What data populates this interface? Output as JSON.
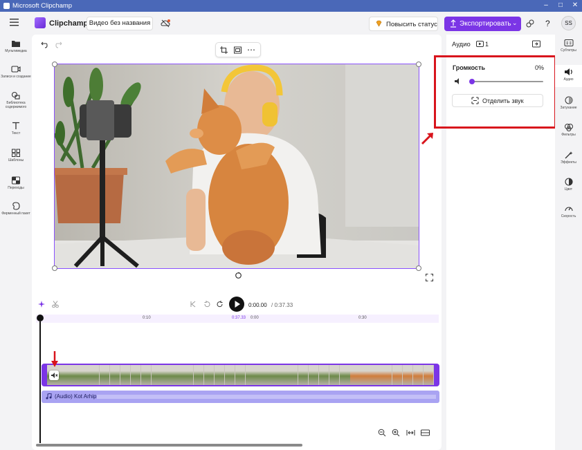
{
  "window": {
    "title": "Microsoft Clipchamp"
  },
  "header": {
    "brand": "Clipchamp",
    "project_name": "Видео без названия",
    "upgrade_label": "Повысить статус",
    "export_label": "Экспортировать",
    "avatar": "SS",
    "help": "?"
  },
  "left_nav": [
    {
      "label": "Мультимедиа",
      "icon": "folder-icon"
    },
    {
      "label": "Записи и создание",
      "icon": "camera-icon"
    },
    {
      "label": "Библиотека содержимого",
      "icon": "library-icon"
    },
    {
      "label": "Текст",
      "icon": "text-icon"
    },
    {
      "label": "Шаблоны",
      "icon": "templates-icon"
    },
    {
      "label": "Переходы",
      "icon": "transitions-icon"
    },
    {
      "label": "Фирменный пакет",
      "icon": "brand-kit-icon"
    }
  ],
  "right_nav": [
    {
      "label": "Субтитры",
      "icon": "captions-icon"
    },
    {
      "label": "Аудио",
      "icon": "speaker-icon"
    },
    {
      "label": "Затухание",
      "icon": "fade-icon"
    },
    {
      "label": "Фильтры",
      "icon": "filters-icon"
    },
    {
      "label": "Эффекты",
      "icon": "effects-icon"
    },
    {
      "label": "Цвет",
      "icon": "color-icon"
    },
    {
      "label": "Скорость",
      "icon": "speed-icon"
    }
  ],
  "panel": {
    "title": "Аудио",
    "track_count": "1",
    "volume_label": "Громкость",
    "volume_value": "0%",
    "volume_level": 0,
    "detach_label": "Отделить звук"
  },
  "playback": {
    "current_time": "0:00.00",
    "total_time": "/ 0:37.33"
  },
  "ruler": {
    "marks": [
      "0:10",
      "0:37.33",
      "0:00",
      "0:30"
    ]
  },
  "audio_track": {
    "label": "(Audio) Kot Arhip"
  },
  "colors": {
    "accent": "#7b35e6",
    "highlight": "#d8141c",
    "titlebar": "#4a68b8"
  }
}
